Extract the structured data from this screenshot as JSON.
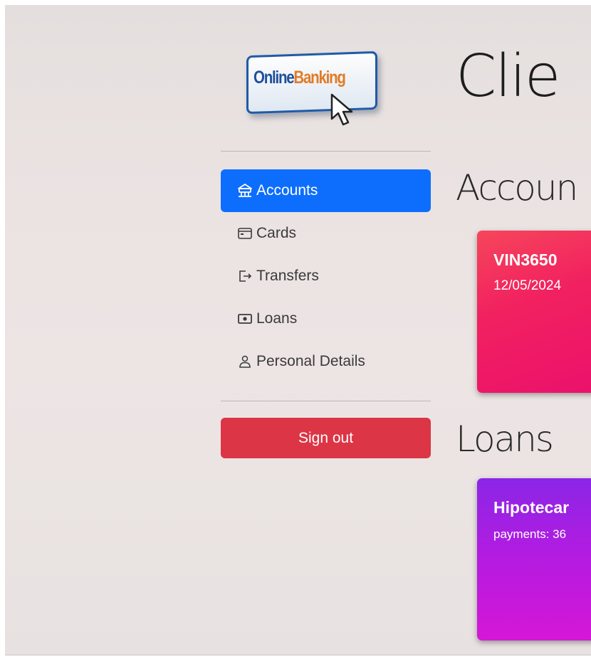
{
  "logo": {
    "word1": "Online",
    "word2": "Banking"
  },
  "sidebar": {
    "items": [
      {
        "label": "Accounts",
        "icon": "bank-icon",
        "active": true
      },
      {
        "label": "Cards",
        "icon": "credit-card-icon",
        "active": false
      },
      {
        "label": "Transfers",
        "icon": "box-arrow-right-icon",
        "active": false
      },
      {
        "label": "Loans",
        "icon": "cash-icon",
        "active": false
      },
      {
        "label": "Personal Details",
        "icon": "person-icon",
        "active": false
      }
    ],
    "signout_label": "Sign out"
  },
  "main": {
    "title": "Clie",
    "accounts": {
      "heading": "Accoun",
      "card": {
        "title": "VIN3650",
        "date": "12/05/2024"
      }
    },
    "loans": {
      "heading": "Loans",
      "card": {
        "title": "Hipotecar",
        "payments": "payments: 36"
      }
    }
  },
  "colors": {
    "primary": "#0d6efd",
    "danger": "#dc3545",
    "account_card": "#f12160",
    "loan_card": "#b51be0",
    "logo_blue": "#1e4f9c",
    "logo_orange": "#e27b25"
  }
}
